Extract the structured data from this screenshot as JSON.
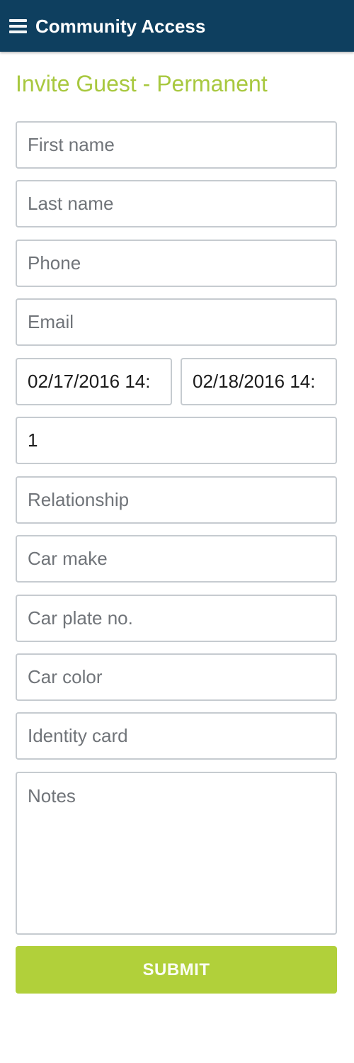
{
  "appbar": {
    "title": "Community Access",
    "menu_icon": "hamburger-menu-icon"
  },
  "page": {
    "title": "Invite Guest - Permanent"
  },
  "form": {
    "first_name": {
      "placeholder": "First name",
      "value": ""
    },
    "last_name": {
      "placeholder": "Last name",
      "value": ""
    },
    "phone": {
      "placeholder": "Phone",
      "value": ""
    },
    "email": {
      "placeholder": "Email",
      "value": ""
    },
    "start_datetime": {
      "value": "02/17/2016 14:"
    },
    "end_datetime": {
      "value": "02/18/2016 14:"
    },
    "guest_count": {
      "value": "1"
    },
    "relationship": {
      "placeholder": "Relationship",
      "value": ""
    },
    "car_make": {
      "placeholder": "Car make",
      "value": ""
    },
    "car_plate": {
      "placeholder": "Car plate no.",
      "value": ""
    },
    "car_color": {
      "placeholder": "Car color",
      "value": ""
    },
    "identity_card": {
      "placeholder": "Identity card",
      "value": ""
    },
    "notes": {
      "placeholder": "Notes",
      "value": ""
    },
    "submit_label": "SUBMIT"
  },
  "colors": {
    "appbar": "#0e3f5f",
    "accent": "#b1d03a",
    "title": "#a8c83f"
  }
}
